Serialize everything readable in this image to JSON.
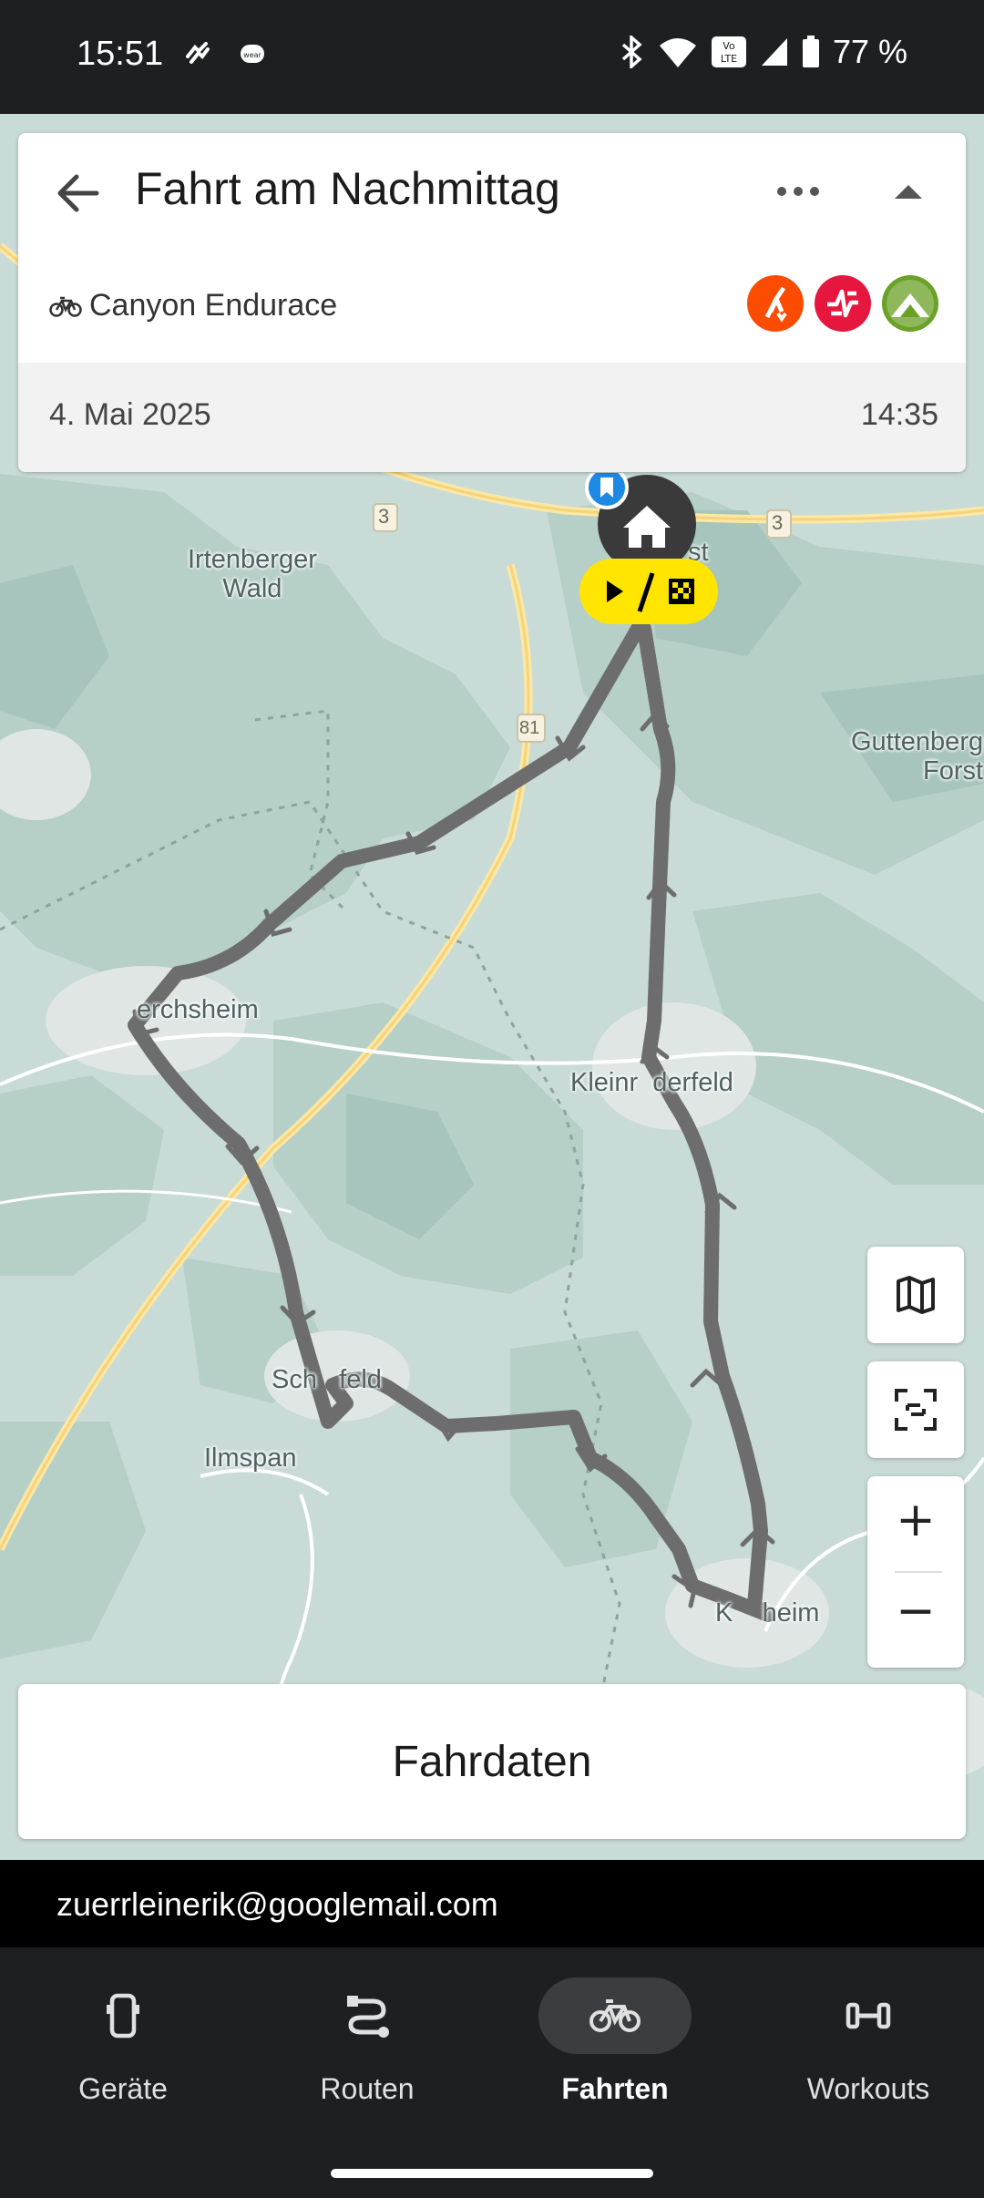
{
  "status_bar": {
    "time": "15:51",
    "battery_percent": "77 %",
    "icons": [
      "notification-icon",
      "wear-icon",
      "bluetooth-icon",
      "wifi-icon",
      "volte-icon",
      "signal-icon",
      "battery-icon"
    ]
  },
  "header": {
    "title": "Fahrt am Nachmittag",
    "bike_name": "Canyon Endurace",
    "date": "4. Mai 2025",
    "time": "14:35",
    "apps": [
      {
        "name": "strava-icon",
        "color": "#fc4c02"
      },
      {
        "name": "intervals-icon",
        "color": "#e5173f"
      },
      {
        "name": "komoot-icon",
        "color": "#6aa127"
      }
    ]
  },
  "map": {
    "places": {
      "irtenberger_wald": "Irtenberger\nWald",
      "guttenberger_forst": "Guttenberg\nForst",
      "kirchheim_top": "st",
      "gerchsheim": "erchsheim",
      "kleinrinderfeld": "Kleinr  derfeld",
      "schoenfeld": "Sch   feld",
      "ilmspan": "Ilmspan",
      "kirchheim": "K    heim",
      "road_3a": "3",
      "road_3b": "3",
      "road_81": "81"
    },
    "route_color": "#6d6d6d",
    "start_badge_color": "#ffe500"
  },
  "controls": {
    "zoom_in": "+",
    "zoom_out": "−"
  },
  "fahrdaten_label": "Fahrdaten",
  "account_email": "zuerrleinerik@googlemail.com",
  "nav": {
    "items": [
      {
        "label": "Geräte",
        "icon": "device-icon",
        "active": false
      },
      {
        "label": "Routen",
        "icon": "route-icon",
        "active": false
      },
      {
        "label": "Fahrten",
        "icon": "bike-icon",
        "active": true
      },
      {
        "label": "Workouts",
        "icon": "dumbbell-icon",
        "active": false
      }
    ]
  }
}
